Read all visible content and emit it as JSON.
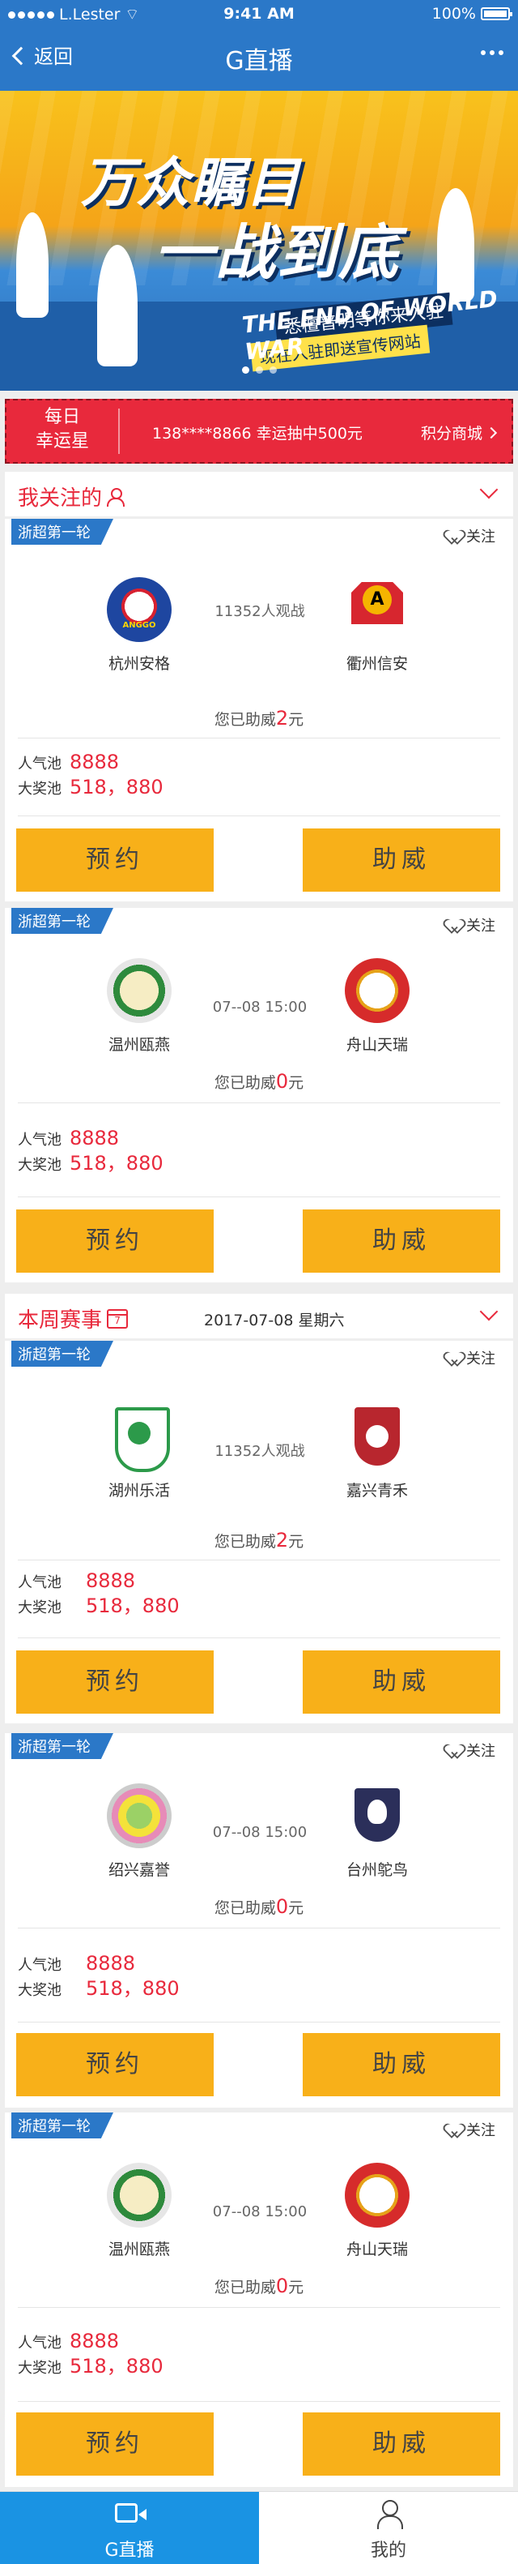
{
  "status_bar": {
    "carrier": "L.Lester",
    "time": "9:41 AM",
    "battery": "100%"
  },
  "nav": {
    "back_label": "返回",
    "title": "G直播"
  },
  "banner": {
    "headline1": "万众瞩目",
    "headline2": "一战到底",
    "sub1": "悉檀普明等你来入驻",
    "sub2": "现在入驻即送宣传网站",
    "english": "THE END OF WORLD WAR"
  },
  "lucky": {
    "label": "每日\n幸运星",
    "message": "138****8866 幸运抽中500元",
    "shop": "积分商城"
  },
  "section_follow": {
    "title": "我关注的"
  },
  "section_week": {
    "title": "本周赛事",
    "cal_day": "7",
    "date": "2017-07-08 星期六"
  },
  "common": {
    "follow_label": "关注",
    "support_prefix": "您已助威",
    "support_suffix": "元",
    "pool_pop_label": "人气池",
    "pool_prize_label": "大奖池",
    "reserve_label": "预约",
    "cheer_label": "助威"
  },
  "matches": [
    {
      "tag": "浙超第一轮",
      "home": "杭州安格",
      "away": "衢州信安",
      "middle": "11352人观战",
      "support": "2",
      "pop_pool": "8888",
      "prize_pool": "518，880"
    },
    {
      "tag": "浙超第一轮",
      "home": "温州瓯燕",
      "away": "舟山天瑞",
      "middle": "07--08  15:00",
      "support": "0",
      "pop_pool": "8888",
      "prize_pool": "518，880"
    },
    {
      "tag": "浙超第一轮",
      "home": "湖州乐活",
      "away": "嘉兴青禾",
      "middle": "11352人观战",
      "support": "2",
      "pop_pool": "8888",
      "prize_pool": "518，880"
    },
    {
      "tag": "浙超第一轮",
      "home": "绍兴嘉誉",
      "away": "台州鸵鸟",
      "middle": "07--08  15:00",
      "support": "0",
      "pop_pool": "8888",
      "prize_pool": "518，880"
    },
    {
      "tag": "浙超第一轮",
      "home": "温州瓯燕",
      "away": "舟山天瑞",
      "middle": "07--08  15:00",
      "support": "0",
      "pop_pool": "8888",
      "prize_pool": "518，880"
    }
  ],
  "tabbar": {
    "live": "G直播",
    "mine": "我的"
  },
  "colors": {
    "brand_blue": "#2b78c8",
    "accent_red": "#e8293c",
    "button_yellow": "#f8b019",
    "tab_active": "#1a93e3"
  }
}
